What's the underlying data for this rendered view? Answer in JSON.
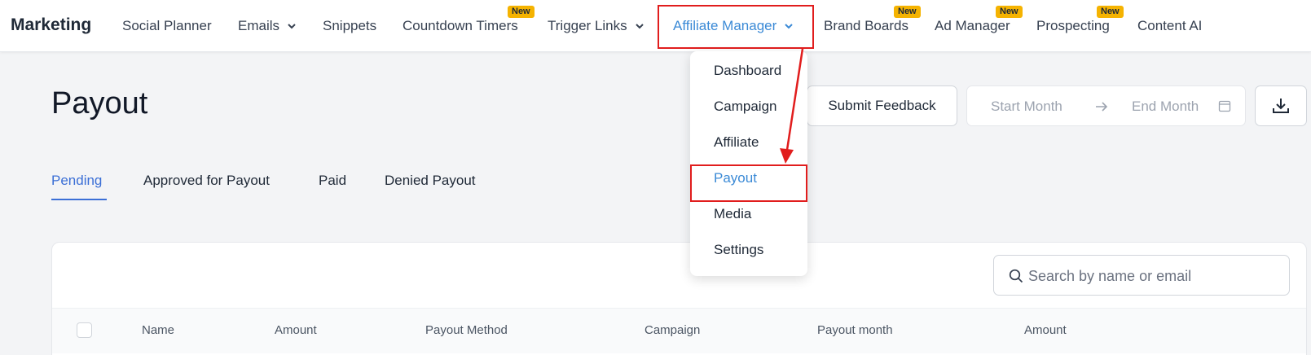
{
  "nav": {
    "brand": "Marketing",
    "items": [
      {
        "label": "Social Planner"
      },
      {
        "label": "Emails"
      },
      {
        "label": "Snippets"
      },
      {
        "label": "Countdown Timers",
        "badge": "New"
      },
      {
        "label": "Trigger Links"
      },
      {
        "label": "Affiliate Manager"
      },
      {
        "label": "Brand Boards",
        "badge": "New"
      },
      {
        "label": "Ad Manager",
        "badge": "New"
      },
      {
        "label": "Prospecting",
        "badge": "New"
      },
      {
        "label": "Content AI"
      }
    ]
  },
  "dropdown": {
    "items": [
      {
        "label": "Dashboard"
      },
      {
        "label": "Campaign"
      },
      {
        "label": "Affiliate"
      },
      {
        "label": "Payout"
      },
      {
        "label": "Media"
      },
      {
        "label": "Settings"
      }
    ]
  },
  "page": {
    "title": "Payout",
    "feedback_label": "Submit Feedback",
    "start_month": "Start Month",
    "end_month": "End Month"
  },
  "tabs": [
    {
      "label": "Pending"
    },
    {
      "label": "Approved for Payout"
    },
    {
      "label": "Paid"
    },
    {
      "label": "Denied Payout"
    }
  ],
  "search": {
    "placeholder": "Search by name or email"
  },
  "table": {
    "columns": [
      "Name",
      "Amount",
      "Payout Method",
      "Campaign",
      "Payout month",
      "Amount"
    ]
  },
  "colors": {
    "accent": "#3b8ad6",
    "tab_active": "#3b6fd6",
    "badge": "#f5b301",
    "annotation": "#e11d1d"
  },
  "icons": [
    "chevron-down-icon",
    "arrow-right-icon",
    "calendar-icon",
    "download-icon",
    "search-icon"
  ]
}
